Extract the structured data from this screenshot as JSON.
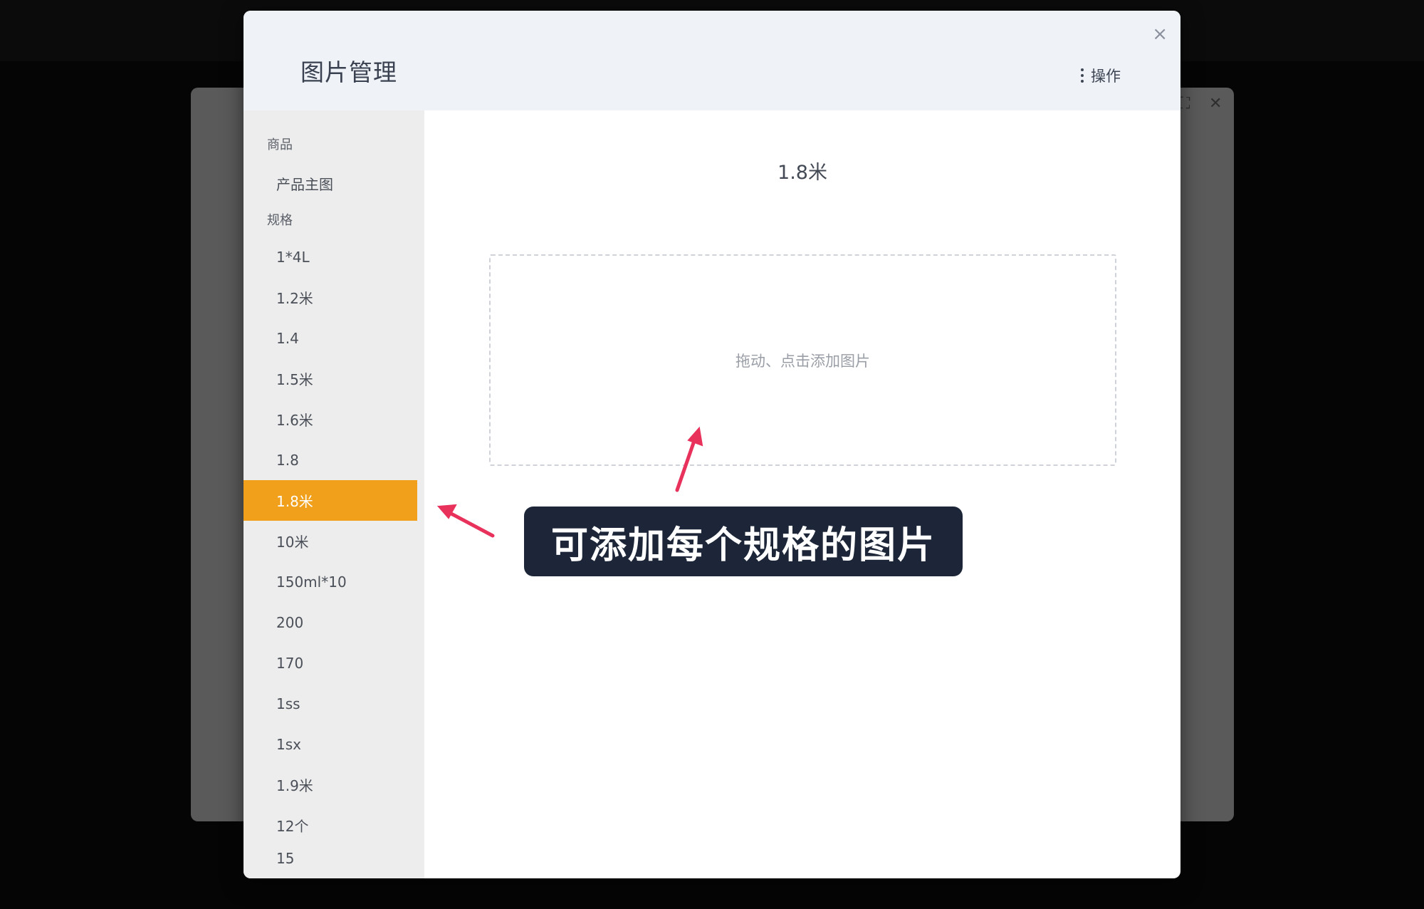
{
  "modal": {
    "title": "图片管理",
    "close_glyph": "×",
    "actions_label": "操作"
  },
  "sidebar": {
    "groups": [
      {
        "label": "商品",
        "items": [
          {
            "label": "产品主图",
            "active": false
          }
        ]
      },
      {
        "label": "规格",
        "items": [
          {
            "label": "1*4L",
            "active": false
          },
          {
            "label": "1.2米",
            "active": false
          },
          {
            "label": "1.4",
            "active": false
          },
          {
            "label": "1.5米",
            "active": false
          },
          {
            "label": "1.6米",
            "active": false
          },
          {
            "label": "1.8",
            "active": false
          },
          {
            "label": "1.8米",
            "active": true
          },
          {
            "label": "10米",
            "active": false
          },
          {
            "label": "150ml*10",
            "active": false
          },
          {
            "label": "200",
            "active": false
          },
          {
            "label": "170",
            "active": false
          },
          {
            "label": "1ss",
            "active": false
          },
          {
            "label": "1sx",
            "active": false
          },
          {
            "label": "1.9米",
            "active": false
          },
          {
            "label": "12个",
            "active": false
          },
          {
            "label": "15",
            "active": false
          }
        ]
      }
    ]
  },
  "content": {
    "title": "1.8米",
    "dropzone_text": "拖动、点击添加图片"
  },
  "annotation": {
    "callout_text": "可添加每个规格的图片",
    "arrow_color": "#e8315b"
  },
  "colors": {
    "active_item": "#f0a01b",
    "header_bg": "#eff2f7",
    "sidebar_bg": "#ededed",
    "callout_bg": "#1c2638"
  }
}
